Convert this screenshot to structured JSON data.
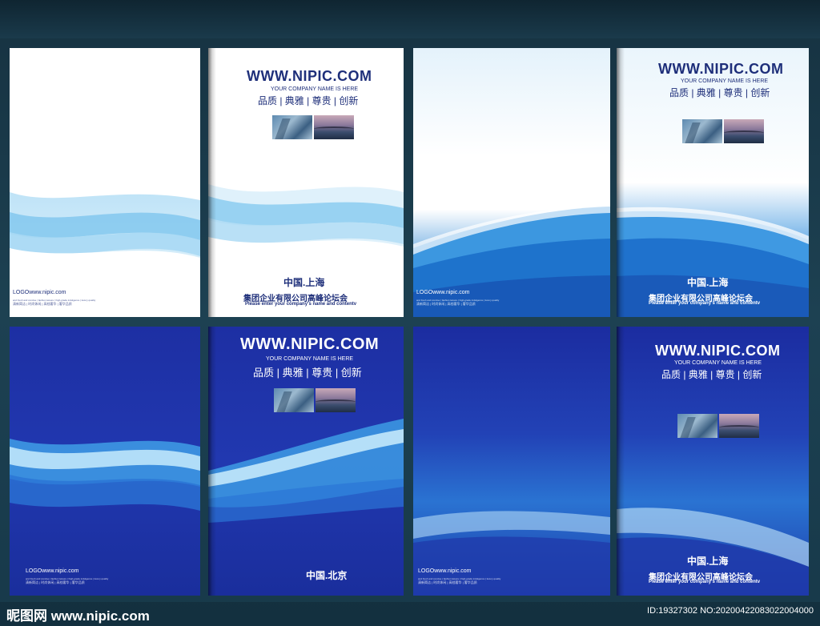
{
  "covers": [
    {
      "url": "WWW.NIPIC.COM",
      "company_en": "YOUR COMPANY NAME IS HERE",
      "tagline": "品质 | 典雅 | 尊贵 | 创新",
      "city": "中国.上海",
      "company_cn": "集团企业有限公司高峰论坛会",
      "enter": "Please enter your company's name and contentv",
      "logo": "LOGOwww.nipic.com",
      "small1": "and fresh and concise  |  fashion leisure  |  high-grade indulgence  |  luxury quality",
      "small2": "清新简洁  |  时尚休闲  |  高档奢华  |  奢华品质"
    },
    {
      "url": "WWW.NIPIC.COM",
      "company_en": "YOUR COMPANY NAME IS HERE",
      "tagline": "品质 | 典雅 | 尊贵 | 创新",
      "city": "中国.上海",
      "company_cn": "集团企业有限公司高峰论坛会",
      "enter": "Please enter your company's name and contentv",
      "logo": "LOGOwww.nipic.com",
      "small1": "and fresh and concise  |  fashion leisure  |  high-grade indulgence  |  luxury quality",
      "small2": "清新简洁  |  时尚休闲  |  高档奢华  |  奢华品质"
    },
    {
      "url": "WWW.NIPIC.COM",
      "company_en": "YOUR COMPANY NAME IS HERE",
      "tagline": "品质 | 典雅 | 尊贵 | 创新",
      "city": "中国.北京",
      "logo": "LOGOwww.nipic.com",
      "small1": "and fresh and concise  |  fashion leisure  |  high-grade indulgence  |  luxury quality",
      "small2": "清新简洁  |  时尚休闲  |  高档奢华  |  奢华品质"
    },
    {
      "url": "WWW.NIPIC.COM",
      "company_en": "YOUR COMPANY NAME IS HERE",
      "tagline": "品质 | 典雅 | 尊贵 | 创新",
      "city": "中国.上海",
      "company_cn": "集团企业有限公司高峰论坛会",
      "enter": "Please enter your company's name and contentv",
      "logo": "LOGOwww.nipic.com",
      "small1": "and fresh and concise  |  fashion leisure  |  high-grade indulgence  |  luxury quality",
      "small2": "清新简洁  |  时尚休闲  |  高档奢华  |  奢华品质"
    }
  ],
  "watermark": {
    "left": "昵图网 www.nipic.com",
    "right": "ID:19327302 NO:20200422083022004000"
  },
  "colors": {
    "navy_text": "#1e2f7a",
    "deep_blue": "#1a2fa0",
    "light_blue": "#3fa6e6"
  }
}
